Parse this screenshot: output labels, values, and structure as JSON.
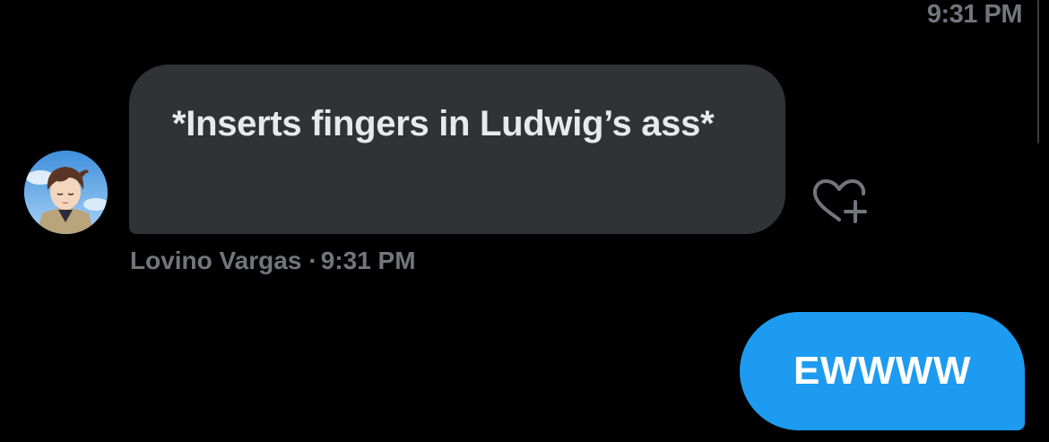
{
  "top": {
    "timestamp": "9:31 PM"
  },
  "received_message": {
    "text": "*Inserts fingers in Ludwig’s ass*",
    "sender_name": "Lovino Vargas",
    "separator": "·",
    "time": "9:31 PM",
    "avatar_icon": "user-avatar",
    "react_icon": "heart-plus-icon",
    "bubble_color": "#2f3336"
  },
  "sent_message": {
    "text": "EWWWW",
    "bubble_color": "#1d9bf0"
  },
  "colors": {
    "background": "#000000",
    "muted_text": "#71767b",
    "accent": "#1d9bf0"
  }
}
